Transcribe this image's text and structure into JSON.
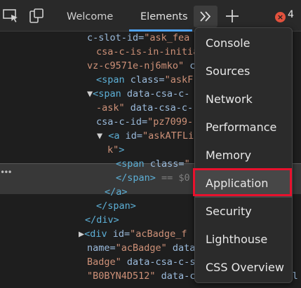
{
  "toolbar": {
    "icons": [
      "inspect-icon",
      "device-emulation-icon"
    ],
    "tabs": [
      {
        "label": "Welcome"
      },
      {
        "label": "Elements",
        "active": true
      }
    ],
    "more_tools_icon": "chevron-double-right-icon",
    "new_tab_icon": "plus-icon",
    "error_badge": "×",
    "error_count": "4"
  },
  "code_lines": [
    {
      "parts": [
        [
          "attr",
          "c-slot-id="
        ],
        [
          "val",
          "\"ask_fea"
        ]
      ]
    },
    {
      "parts": [
        [
          "val",
          "csa-c-is-in-initial"
        ]
      ]
    },
    {
      "parts": [
        [
          "val",
          "vz-c9571e-nj6mko\""
        ],
        [
          "attr",
          " c"
        ]
      ]
    },
    {
      "parts": [
        [
          "tag",
          "<span "
        ],
        [
          "attr",
          "class="
        ],
        [
          "val",
          "\"askF"
        ]
      ]
    },
    {
      "parts": [
        [
          "txt",
          "▼"
        ],
        [
          "tag",
          "<span "
        ],
        [
          "attr",
          "data-csa-c-"
        ]
      ]
    },
    {
      "parts": [
        [
          "val",
          "-ask\""
        ],
        [
          "attr",
          " data-csa-c-"
        ]
      ]
    },
    {
      "parts": [
        [
          "attr",
          "csa-c-id="
        ],
        [
          "val",
          "\"pz7099-"
        ]
      ]
    },
    {
      "parts": [
        [
          "txt",
          "▼ "
        ],
        [
          "tag",
          "<a "
        ],
        [
          "attr",
          "id="
        ],
        [
          "val",
          "\"askATFLi"
        ]
      ]
    },
    {
      "parts": [
        [
          "val",
          "k\""
        ],
        [
          "tag",
          ">"
        ]
      ]
    },
    {
      "parts": [
        [
          "tag",
          "<span "
        ],
        [
          "attr",
          "class="
        ],
        [
          "val",
          "\""
        ]
      ]
    },
    {
      "parts": [
        [
          "tag",
          "</span>"
        ],
        [
          "muted",
          " == $0"
        ]
      ]
    },
    {
      "parts": [
        [
          "tag",
          "</a>"
        ]
      ]
    },
    {
      "parts": [
        [
          "tag",
          "</span>"
        ]
      ]
    },
    {
      "parts": [
        [
          "tag",
          "</div>"
        ]
      ]
    },
    {
      "parts": [
        [
          "txt",
          "▶"
        ],
        [
          "tag",
          "<div "
        ],
        [
          "attr",
          "id="
        ],
        [
          "val",
          "\"acBadge_f"
        ]
      ]
    },
    {
      "parts": [
        [
          "attr",
          "name="
        ],
        [
          "val",
          "\"acBadge\""
        ],
        [
          "attr",
          " data"
        ]
      ]
    },
    {
      "parts": [
        [
          "val",
          "Badge\""
        ],
        [
          "attr",
          " data-csa-c-s"
        ]
      ]
    },
    {
      "parts": [
        [
          "val",
          "\"B0BYN4D512\""
        ],
        [
          "attr",
          " data-csa-c-is-in-initial"
        ]
      ]
    }
  ],
  "menu": {
    "items": [
      {
        "label": "Console"
      },
      {
        "label": "Sources"
      },
      {
        "label": "Network"
      },
      {
        "label": "Performance"
      },
      {
        "label": "Memory"
      },
      {
        "label": "Application",
        "highlighted": true
      },
      {
        "label": "Security"
      },
      {
        "label": "Lighthouse"
      },
      {
        "label": "CSS Overview"
      }
    ]
  },
  "colors": {
    "toolbar_bg": "#292929",
    "code_bg": "#1e1e1e",
    "menu_bg": "#2b2b2b",
    "active_tab_underline": "#4fa3f7",
    "error_badge": "#e2513d",
    "highlight_box": "#e8112d"
  }
}
